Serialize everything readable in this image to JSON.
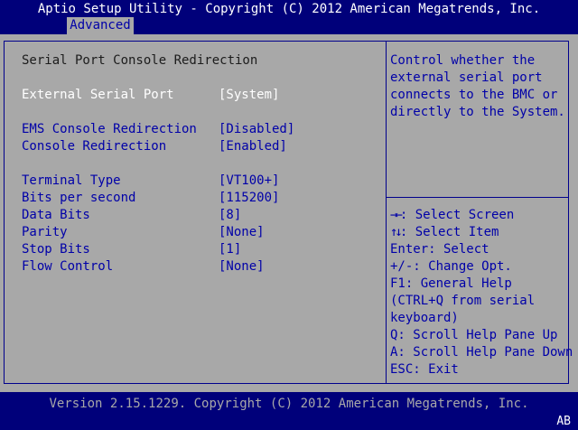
{
  "title": "Aptio Setup Utility - Copyright (C) 2012 American Megatrends, Inc.",
  "tab": "Advanced",
  "section_title": "Serial Port Console Redirection",
  "settings": [
    {
      "label": "External Serial Port",
      "value": "[System]"
    },
    {
      "label": "EMS Console Redirection",
      "value": "[Disabled]"
    },
    {
      "label": "Console Redirection",
      "value": "[Enabled]"
    },
    {
      "label": "Terminal Type",
      "value": "[VT100+]"
    },
    {
      "label": "Bits per second",
      "value": "[115200]"
    },
    {
      "label": "Data Bits",
      "value": "[8]"
    },
    {
      "label": "Parity",
      "value": "[None]"
    },
    {
      "label": "Stop Bits",
      "value": "[1]"
    },
    {
      "label": "Flow Control",
      "value": "[None]"
    }
  ],
  "help_text": [
    "Control whether the",
    "external serial port",
    "connects to the BMC or",
    "directly to the System."
  ],
  "keys": [
    {
      "key": "→←",
      "desc": ": Select Screen"
    },
    {
      "key": "↑↓",
      "desc": ": Select Item"
    },
    {
      "key": "",
      "desc": "Enter: Select"
    },
    {
      "key": "",
      "desc": "+/-: Change Opt."
    },
    {
      "key": "",
      "desc": "F1: General Help"
    },
    {
      "key": "",
      "desc": "(CTRL+Q from serial"
    },
    {
      "key": "",
      "desc": "keyboard)"
    },
    {
      "key": "",
      "desc": "Q: Scroll Help Pane Up"
    },
    {
      "key": "",
      "desc": "A: Scroll Help Pane Down"
    },
    {
      "key": "",
      "desc": "ESC: Exit"
    }
  ],
  "footer": "Version 2.15.1229. Copyright (C) 2012 American Megatrends, Inc.",
  "corner_badge": "AB",
  "colors": {
    "header_bg": "#00007a",
    "panel_bg": "#a8a8a8",
    "selected_text": "#ffffff",
    "item_text": "#0000a8"
  }
}
